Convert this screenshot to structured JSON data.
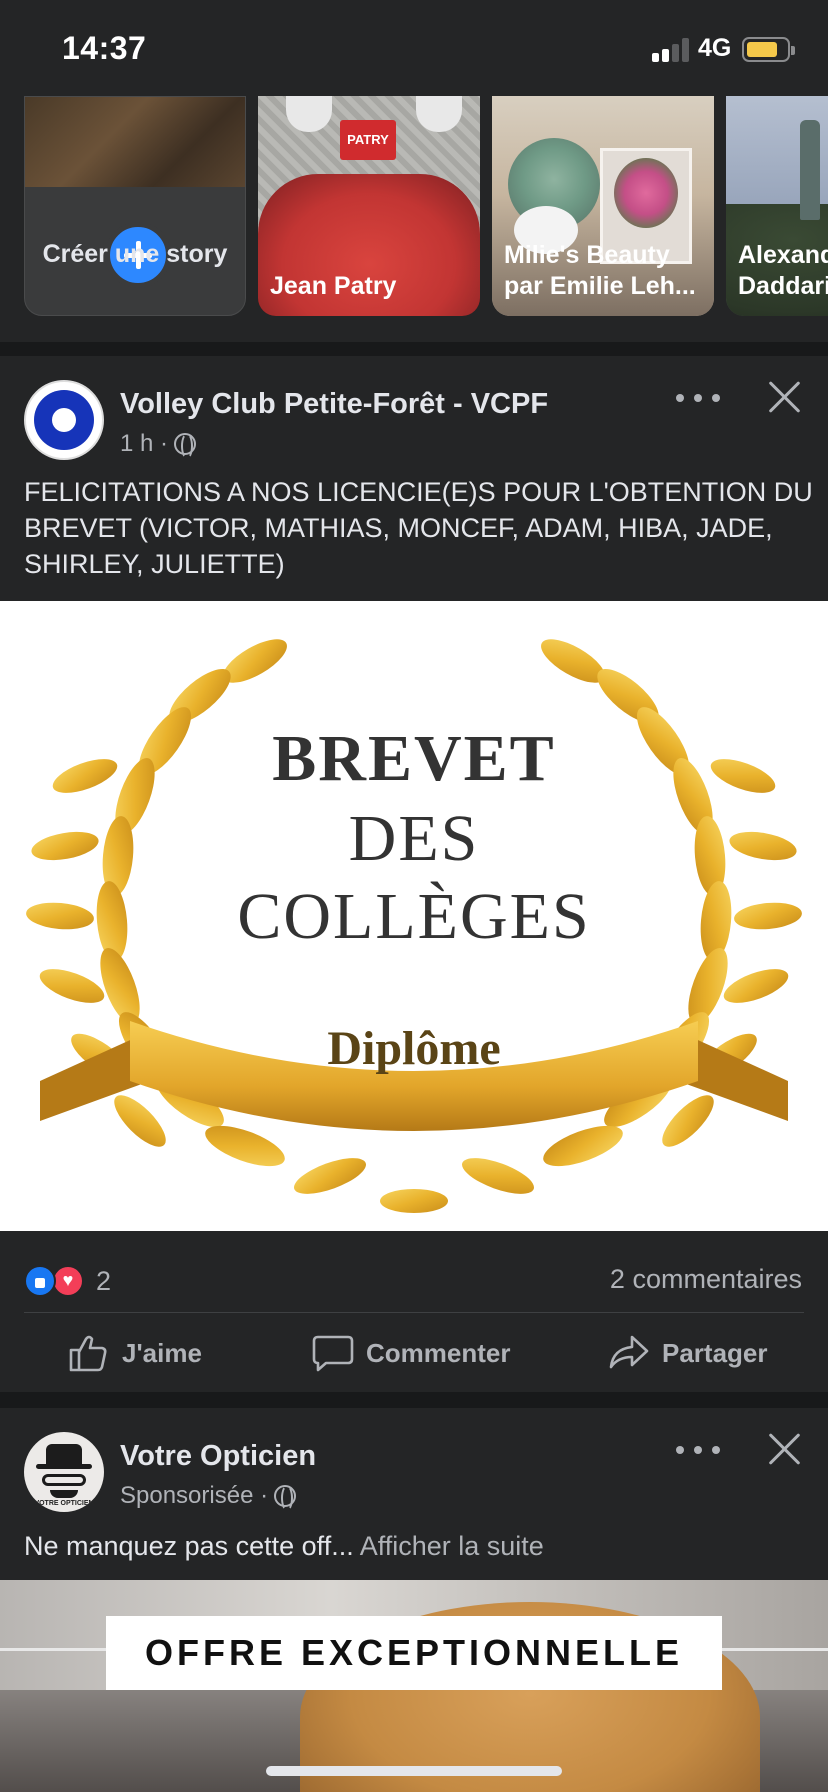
{
  "status_bar": {
    "time": "14:37",
    "network": "4G",
    "battery_color": "#f4c84a"
  },
  "stories": {
    "create": {
      "label": "Créer une story"
    },
    "items": [
      {
        "label": "Jean Patry",
        "tag": "PATRY"
      },
      {
        "label": "Milie's Beauty par Emilie Leh..."
      },
      {
        "label": "Alexandre Daddari"
      }
    ]
  },
  "post1": {
    "author": "Volley Club Petite-Forêt  - VCPF",
    "time": "1 h ·",
    "text": "FELICITATIONS A NOS LICENCIE(E)S POUR L'OBTENTION DU BREVET (VICTOR, MATHIAS, MONCEF, ADAM, HIBA, JADE, SHIRLEY, JULIETTE)",
    "image": {
      "line1": "BREVET",
      "line2": "DES",
      "line3": "COLLÈGES",
      "ribbon": "Diplôme"
    },
    "reaction_count": "2",
    "comment_count": "2 commentaires",
    "actions": {
      "like": "J'aime",
      "comment": "Commenter",
      "share": "Partager"
    }
  },
  "post2": {
    "author": "Votre Opticien",
    "meta": "Sponsorisée ·",
    "text": "Ne manquez pas cette off...",
    "see_more": "Afficher la suite",
    "avatar_caption": "VOTRE OPTICIEN",
    "ad_banner": "OFFRE EXCEPTIONNELLE"
  },
  "colors": {
    "background": "#18191a",
    "card": "#242526",
    "text_primary": "#e4e6eb",
    "text_secondary": "#b0b3b8",
    "accent_blue": "#2d88ff",
    "like_blue": "#1877f2",
    "heart_red": "#f33e58"
  }
}
